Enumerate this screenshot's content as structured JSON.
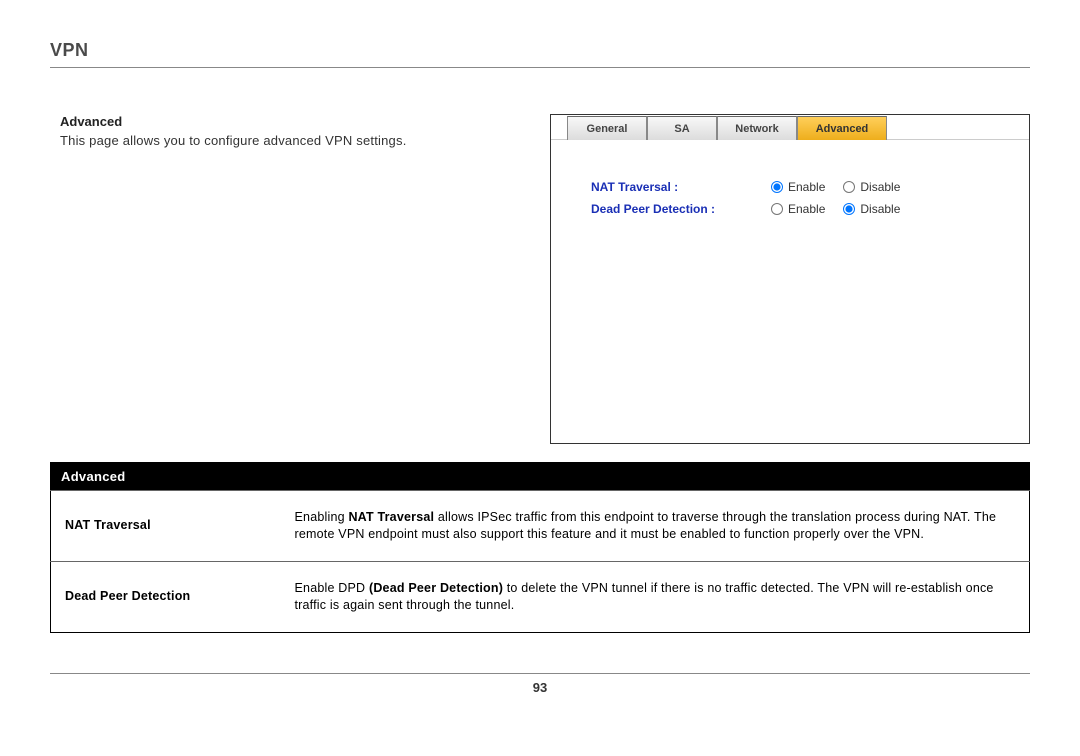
{
  "page": {
    "title": "VPN",
    "number": "93"
  },
  "intro": {
    "heading": "Advanced",
    "description": "This page allows you to configure advanced VPN settings."
  },
  "screenshot": {
    "tabs": {
      "general": "General",
      "sa": "SA",
      "network": "Network",
      "advanced": "Advanced"
    },
    "rows": {
      "nat": {
        "label": "NAT Traversal :",
        "enable": "Enable",
        "disable": "Disable"
      },
      "dpd": {
        "label": "Dead Peer Detection :",
        "enable": "Enable",
        "disable": "Disable"
      }
    }
  },
  "def": {
    "header": "Advanced",
    "nat": {
      "term": "NAT Traversal",
      "pre": "Enabling ",
      "bold": "NAT Traversal",
      "post": " allows IPSec traffic from this endpoint to traverse through the translation process during NAT. The remote VPN endpoint must also support this feature and it must be enabled to function properly over the VPN."
    },
    "dpd": {
      "term": "Dead Peer Detection",
      "pre": "Enable DPD ",
      "bold": "(Dead Peer Detection)",
      "post": " to delete the VPN tunnel if there is no traffic detected. The VPN will re-establish once traffic is again sent through the tunnel."
    }
  }
}
